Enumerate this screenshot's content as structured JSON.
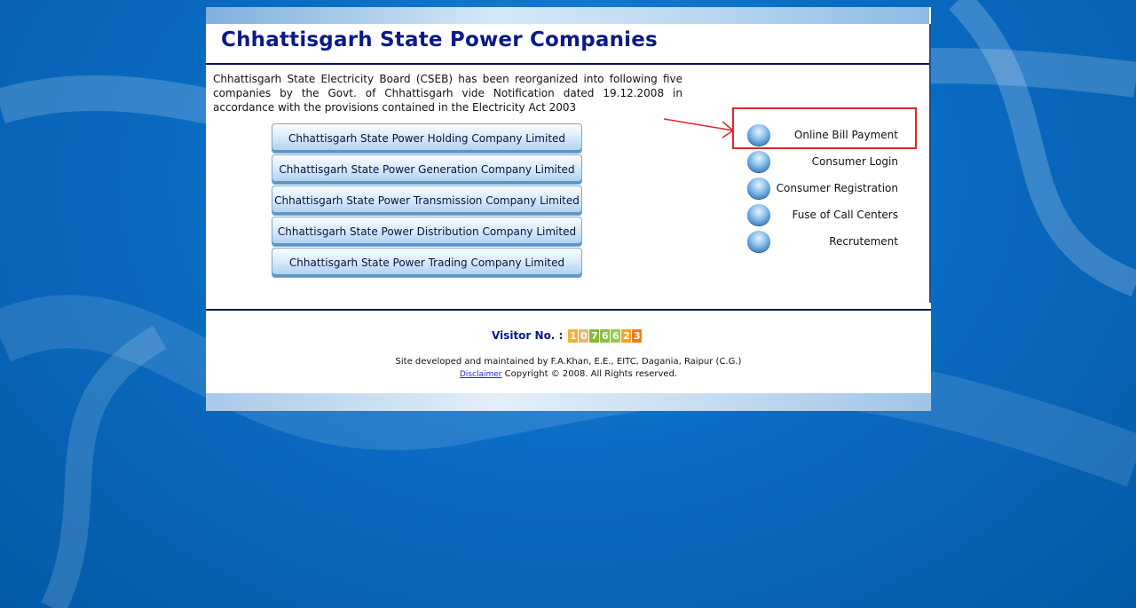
{
  "header": {
    "title": "Chhattisgarh State Power Companies"
  },
  "intro": {
    "text": "Chhattisgarh State Electricity Board (CSEB) has been reorganized into following five companies by the Govt. of Chhattisgarh vide Notification dated 19.12.2008 in accordance with the provisions contained in the Electricity Act 2003"
  },
  "companies": [
    {
      "label": "Chhattisgarh State Power Holding Company Limited"
    },
    {
      "label": "Chhattisgarh State Power Generation Company Limited"
    },
    {
      "label": "Chhattisgarh State Power Transmission Company Limited"
    },
    {
      "label": "Chhattisgarh State Power Distribution Company Limited"
    },
    {
      "label": "Chhattisgarh State Power Trading Company Limited"
    }
  ],
  "menu": [
    {
      "label": "Online Bill Payment",
      "icon": "orb-bullet-icon"
    },
    {
      "label": "Consumer Login",
      "icon": "orb-bullet-icon"
    },
    {
      "label": "Consumer Registration",
      "icon": "orb-bullet-icon"
    },
    {
      "label": "Fuse of Call Centers",
      "icon": "orb-bullet-icon"
    },
    {
      "label": "Recrutement",
      "icon": "orb-bullet-icon"
    }
  ],
  "annotation": {
    "highlight_color": "#e0262a",
    "highlighted_item": "Online Bill Payment"
  },
  "visitor": {
    "label": "Visitor No. :",
    "digits": [
      "1",
      "0",
      "7",
      "6",
      "6",
      "2",
      "3"
    ],
    "digit_colors": [
      "#f2b233",
      "#e3b77a",
      "#86b93a",
      "#8cc043",
      "#9ac84a",
      "#f4a623",
      "#f27c1a"
    ]
  },
  "footer": {
    "credit": "Site developed and maintained by F.A.Khan, E.E., EITC, Dagania, Raipur (C.G.)",
    "disclaimer": "Disclaimer",
    "copyright": "Copyright © 2008. All Rights reserved."
  },
  "colors": {
    "title": "#0c1a86",
    "rule": "#0c1466",
    "background": "#0a6cc4"
  }
}
